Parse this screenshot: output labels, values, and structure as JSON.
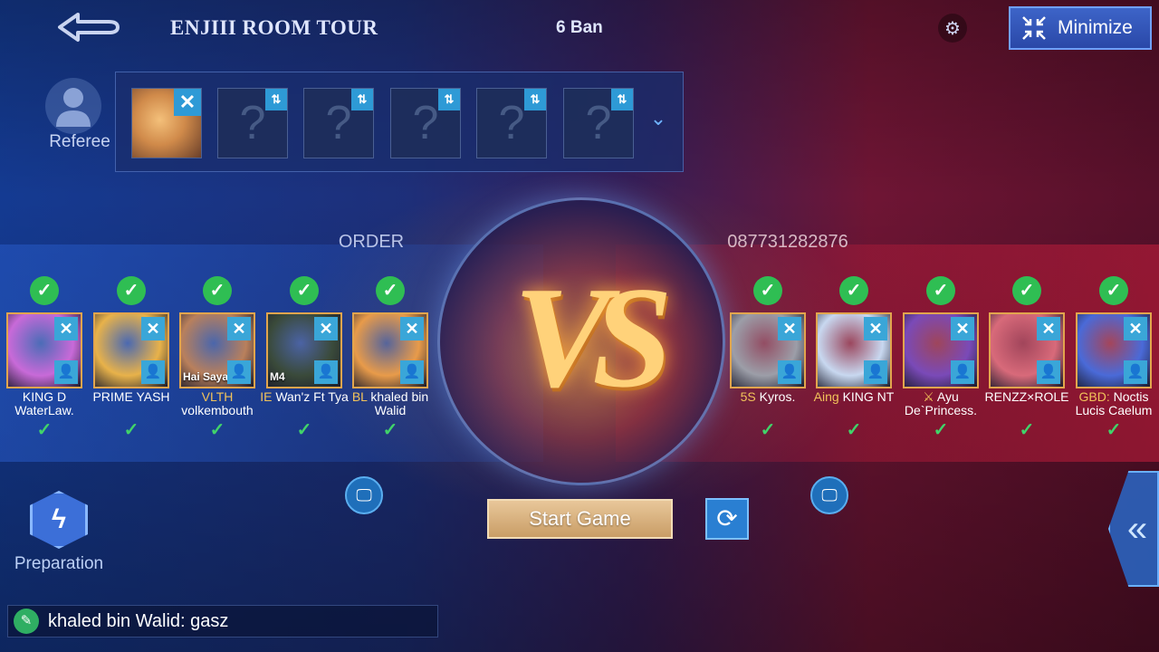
{
  "header": {
    "room_title": "ENJIII ROOM TOUR",
    "ban_count": "6 Ban",
    "minimize_label": "Minimize"
  },
  "referee": {
    "label": "Referee"
  },
  "ban_slots": [
    {
      "filled": true
    },
    {
      "filled": false,
      "placeholder": "?"
    },
    {
      "filled": false,
      "placeholder": "?"
    },
    {
      "filled": false,
      "placeholder": "?"
    },
    {
      "filled": false,
      "placeholder": "?"
    },
    {
      "filled": false,
      "placeholder": "?"
    }
  ],
  "teams": {
    "left": {
      "name": "ORDER"
    },
    "right": {
      "name": "087731282876"
    }
  },
  "vs_label": "VS",
  "left_players": [
    {
      "tag": "",
      "name": "KING D WaterLaw.",
      "ready": true,
      "avatar_color": "#c86ad8"
    },
    {
      "tag": "",
      "name": "PRIME YASH",
      "ready": true,
      "avatar_color": "#e8b24a"
    },
    {
      "tag": "VLTH",
      "name": "volkembouth",
      "ready": true,
      "avatar_color": "#b9805c",
      "avatar_text": "Hai Saya"
    },
    {
      "tag": "IE",
      "name": "Wan'z Ft Tya",
      "ready": true,
      "avatar_color": "#3a4a3a",
      "avatar_text": "M4"
    },
    {
      "tag": "BL",
      "name": "khaled bin Walid",
      "ready": true,
      "avatar_color": "#e89b4a"
    }
  ],
  "right_players": [
    {
      "tag": "5S",
      "name": "Kyros.",
      "ready": true,
      "avatar_color": "#9c9ea8"
    },
    {
      "tag": "Aing",
      "name": "KING NT",
      "ready": true,
      "avatar_color": "#c8d8f0"
    },
    {
      "tag": "⚔",
      "name": "Ayu De`Princess.",
      "ready": true,
      "avatar_color": "#7a4ab8"
    },
    {
      "tag": "",
      "name": "RENZZ×ROLE",
      "ready": true,
      "avatar_color": "#d86a7a"
    },
    {
      "tag": "GBD:",
      "name": "Noctis Lucis Caelum",
      "ready": true,
      "avatar_color": "#4a6ad8"
    }
  ],
  "buttons": {
    "start_game": "Start Game",
    "preparation": "Preparation"
  },
  "chat": {
    "message": "khaled bin Walid: gasz"
  },
  "colors": {
    "left_team": "#2a5fd0",
    "right_team": "#c81e3c",
    "ready": "#2fbe53",
    "tag_gold": "#f2c35a"
  }
}
